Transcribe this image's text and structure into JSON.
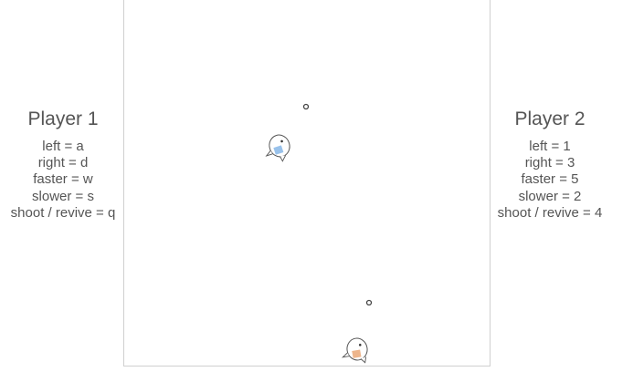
{
  "players": [
    {
      "title": "Player 1",
      "controls": [
        "left = a",
        "right = d",
        "faster = w",
        "slower = s",
        "shoot / revive = q"
      ],
      "accent": "#7fb3e6"
    },
    {
      "title": "Player 2",
      "controls": [
        "left = 1",
        "right = 3",
        "faster = 5",
        "slower = 2",
        "shoot / revive = 4"
      ],
      "accent": "#e8a36f"
    }
  ],
  "field": {
    "border_color": "#cfcfcf",
    "background": "#ffffff"
  },
  "sprites": {
    "ship_icon": "seal-ship-icon",
    "projectile_icon": "ring-bullet-icon"
  }
}
